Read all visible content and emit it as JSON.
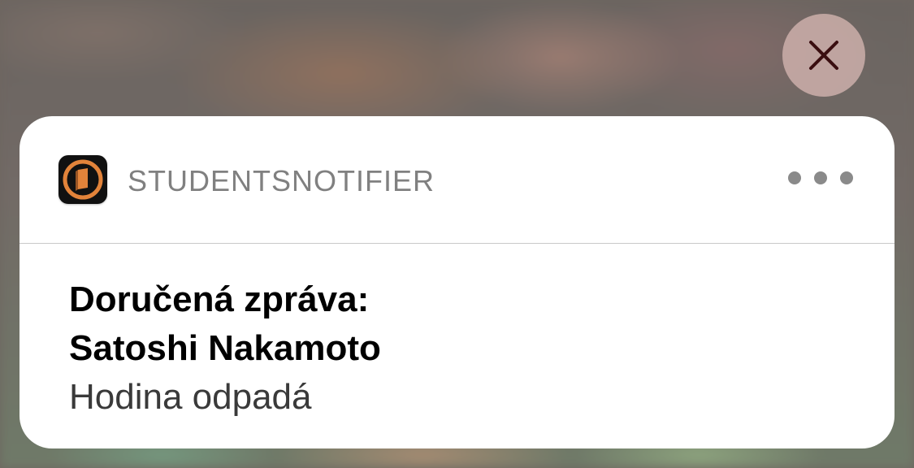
{
  "notification": {
    "app_name": "STUDENTSNOTIFIER",
    "app_icon": "book-logo-icon",
    "title_line1": "Doručená zpráva:",
    "title_line2": "Satoshi Nakamoto",
    "message": "Hodina odpadá",
    "close_icon": "close-icon",
    "more_icon": "more-options-icon"
  },
  "colors": {
    "card_background": "#ffffff",
    "app_name_text": "#808080",
    "title_text": "#000000",
    "message_text": "#3a3a3a",
    "icon_accent": "#e2833a",
    "close_button_background": "#cdafaa"
  }
}
